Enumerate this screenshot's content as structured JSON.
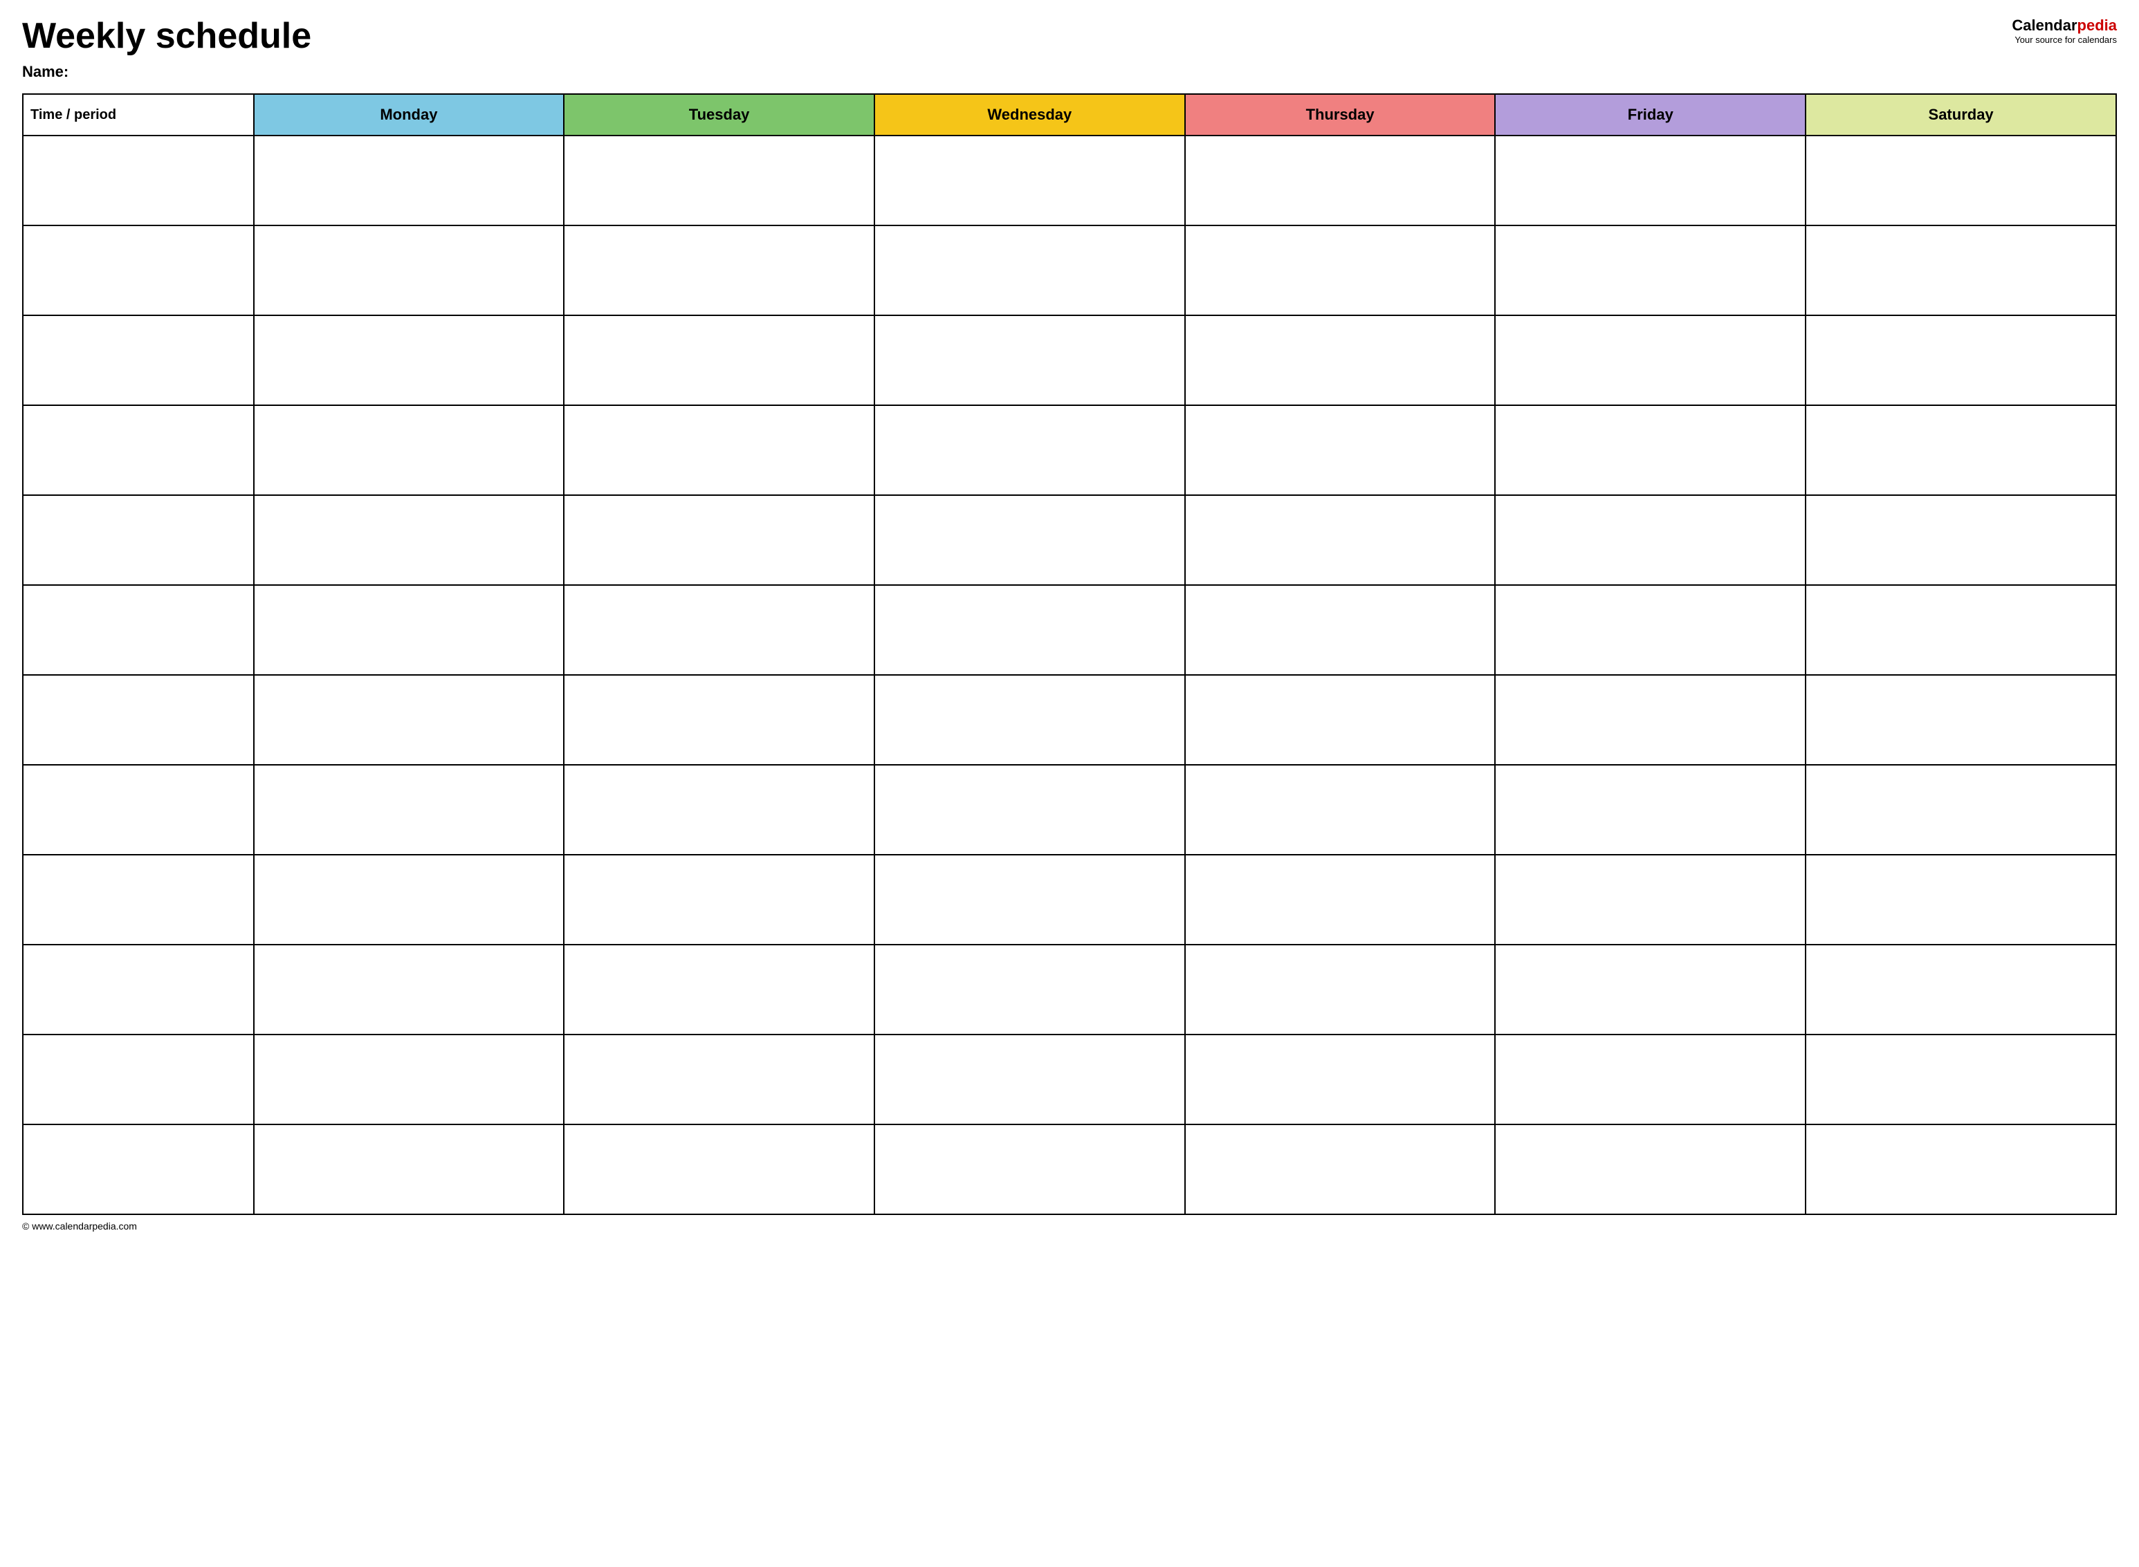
{
  "header": {
    "title": "Weekly schedule",
    "name_label": "Name:",
    "logo_calendar": "Calendar",
    "logo_pedia": "pedia",
    "logo_tagline": "Your source for calendars"
  },
  "table": {
    "headers": [
      {
        "id": "time",
        "label": "Time / period",
        "class": "th-time"
      },
      {
        "id": "monday",
        "label": "Monday",
        "class": "th-monday"
      },
      {
        "id": "tuesday",
        "label": "Tuesday",
        "class": "th-tuesday"
      },
      {
        "id": "wednesday",
        "label": "Wednesday",
        "class": "th-wednesday"
      },
      {
        "id": "thursday",
        "label": "Thursday",
        "class": "th-thursday"
      },
      {
        "id": "friday",
        "label": "Friday",
        "class": "th-friday"
      },
      {
        "id": "saturday",
        "label": "Saturday",
        "class": "th-saturday"
      }
    ],
    "row_count": 12
  },
  "footer": {
    "url": "© www.calendarpedia.com"
  }
}
